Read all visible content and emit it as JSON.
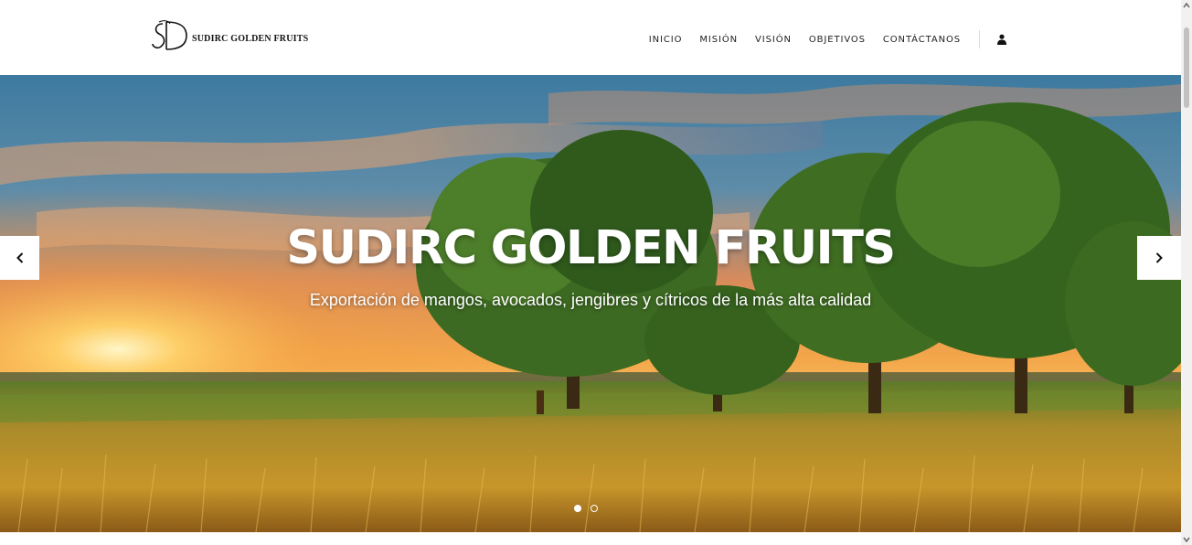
{
  "brand": {
    "logo_text": "SUDIRC GOLDEN FRUITS"
  },
  "nav": {
    "items": [
      {
        "label": "INICIO"
      },
      {
        "label": "MISIÓN"
      },
      {
        "label": "VISIÓN"
      },
      {
        "label": "OBJETIVOS"
      },
      {
        "label": "CONTÁCTANOS"
      }
    ],
    "user_icon": "user-icon"
  },
  "hero": {
    "title": "SUDIRC GOLDEN FRUITS",
    "subtitle": "Exportación de mangos, avocados, jengibres y cítricos de la más alta calidad",
    "prev_icon": "chevron-left-icon",
    "next_icon": "chevron-right-icon",
    "slides_total": 2,
    "active_slide": 1
  },
  "colors": {
    "header_bg": "#ffffff",
    "nav_text": "#222222",
    "hero_text": "#ffffff"
  }
}
